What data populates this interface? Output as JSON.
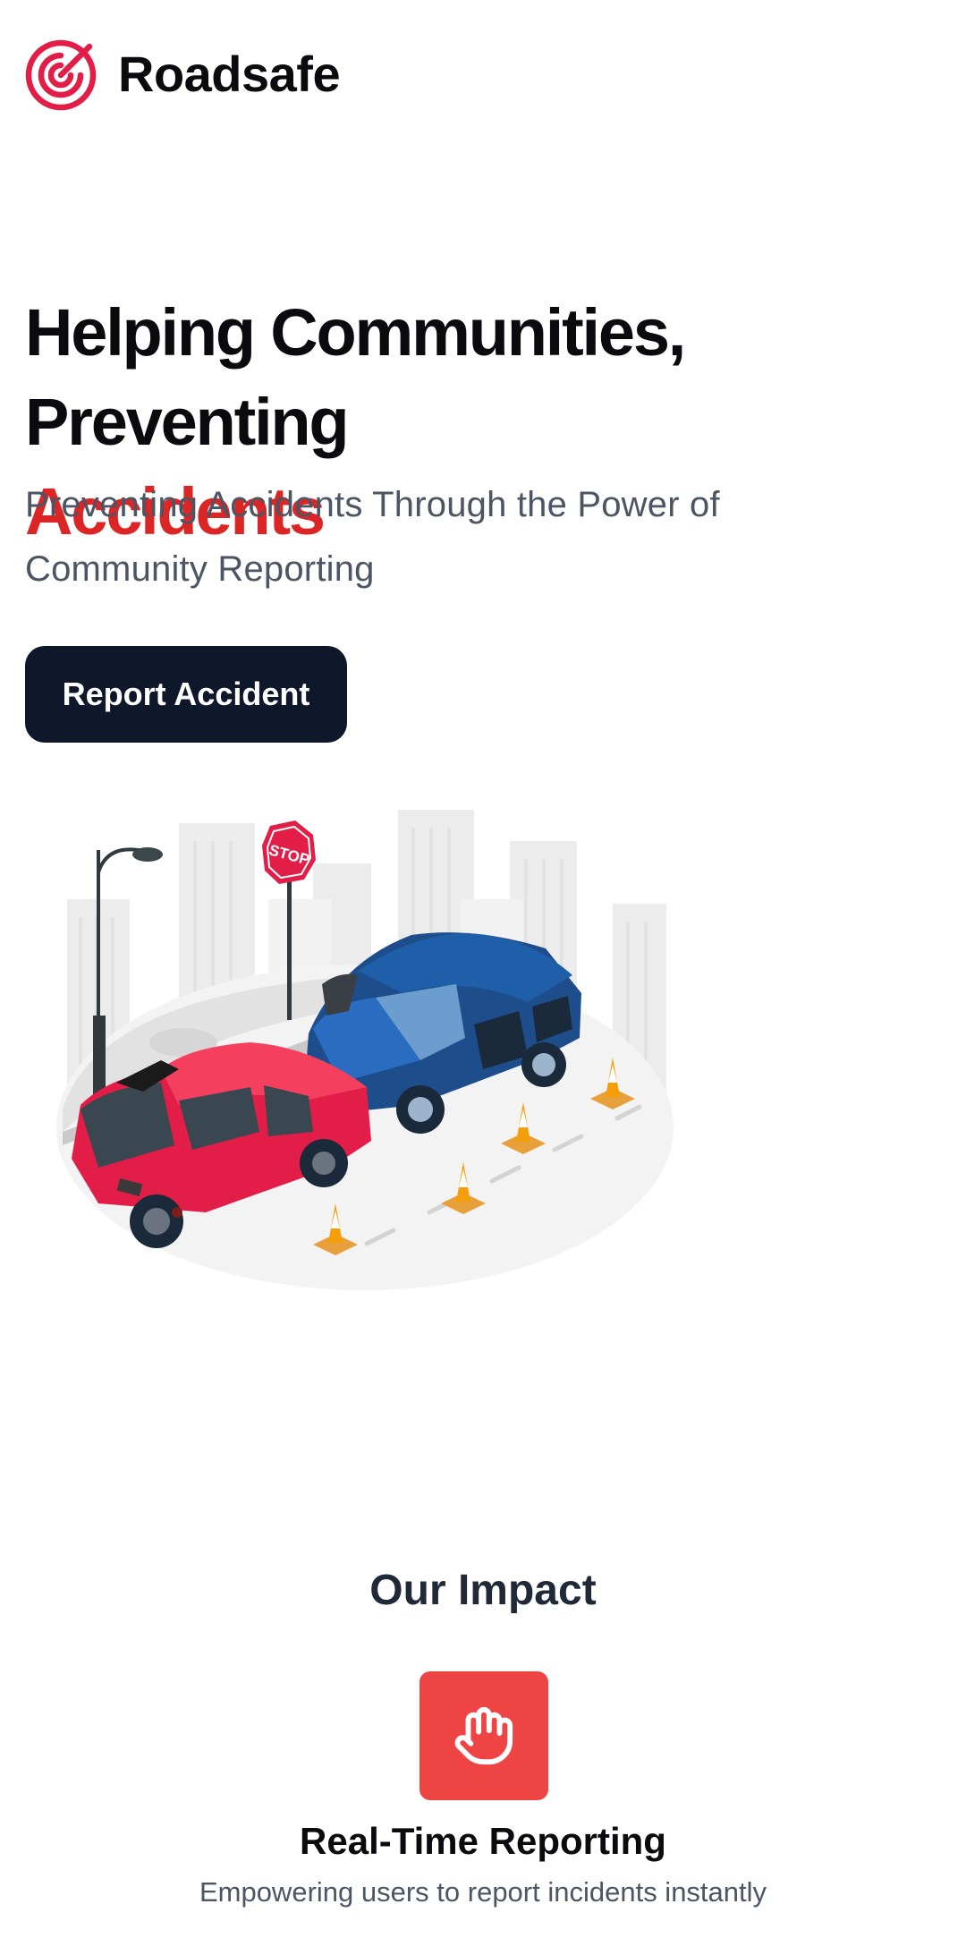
{
  "header": {
    "brand": "Roadsafe",
    "logo_icon": "radar-target-icon",
    "brand_color": "#e11d48"
  },
  "hero": {
    "title_line": "Helping Communities, Preventing",
    "title_accent": "Accidents",
    "accent_color": "#dc2626",
    "subtitle": "Preventing Accidents Through the Power of Community Reporting",
    "cta_label": "Report Accident",
    "illustration": "car-accident-illustration"
  },
  "impact": {
    "heading": "Our Impact",
    "items": [
      {
        "icon": "hand-stop-icon",
        "icon_bg": "#ef4444",
        "title": "Real-Time Reporting",
        "description": "Empowering users to report incidents instantly"
      }
    ]
  }
}
